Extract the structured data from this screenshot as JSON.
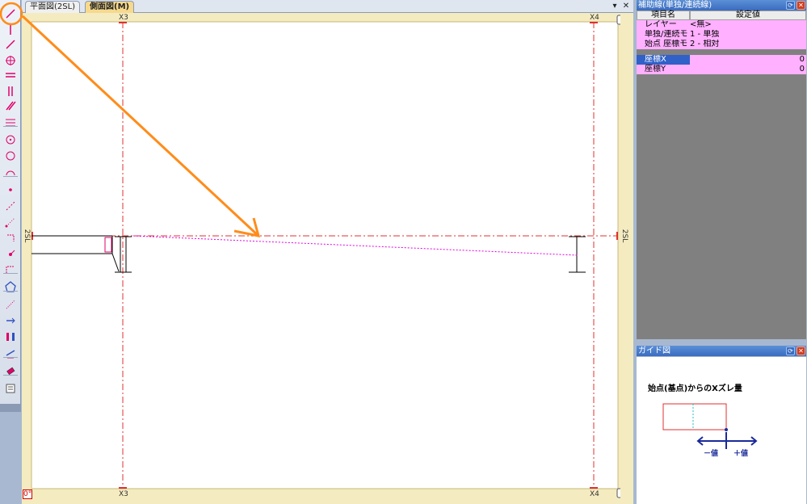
{
  "document": {
    "tabs": [
      {
        "label": "平面図(2SL)",
        "active": false
      },
      {
        "label": "側面図(M)",
        "active": true
      }
    ],
    "controls": {
      "dropdown": "▾",
      "close": "✕"
    }
  },
  "canvas": {
    "grid_labels": {
      "x3": "X3",
      "x4": "X4",
      "level": "2SL"
    },
    "angle": "0°"
  },
  "properties_panel": {
    "title": "補助線(単独/連続線)",
    "headers": {
      "item": "項目名",
      "value": "設定値"
    },
    "rows": [
      {
        "key": "レイヤー",
        "value": "<無>"
      },
      {
        "key": "単独/連続モ",
        "value": "1 - 単独"
      },
      {
        "key": "始点 座標モ",
        "value": "2 - 相対"
      },
      {
        "key": "座標X",
        "value": "0"
      },
      {
        "key": "座標Y",
        "value": "0"
      }
    ]
  },
  "guide_panel": {
    "title": "ガイド図",
    "caption": "始点(基点)からのXズレ量",
    "minus_label": "－値",
    "plus_label": "＋値"
  },
  "toolbar": {
    "icons": [
      "line-tool-icon",
      "vertical-line-icon",
      "diagonal-line-icon",
      "crosshair-icon",
      "horizontal-double-icon",
      "vertical-double-icon",
      "slant-double-icon",
      "parallel-lines-icon",
      "circle-center-icon",
      "circle-icon",
      "arc-icon",
      "point-icon",
      "dotted-diag-icon",
      "dotted-diag-2-icon",
      "bracket-icon",
      "node-point-icon",
      "corner-dotted-icon",
      "polygon-icon",
      "dotted-line-icon",
      "arrow-right-icon",
      "column-icon",
      "measure-icon",
      "eraser-icon",
      "list-icon"
    ],
    "colors": {
      "accent": "#e0006a",
      "orange_highlight": "#ff8c1a"
    }
  }
}
